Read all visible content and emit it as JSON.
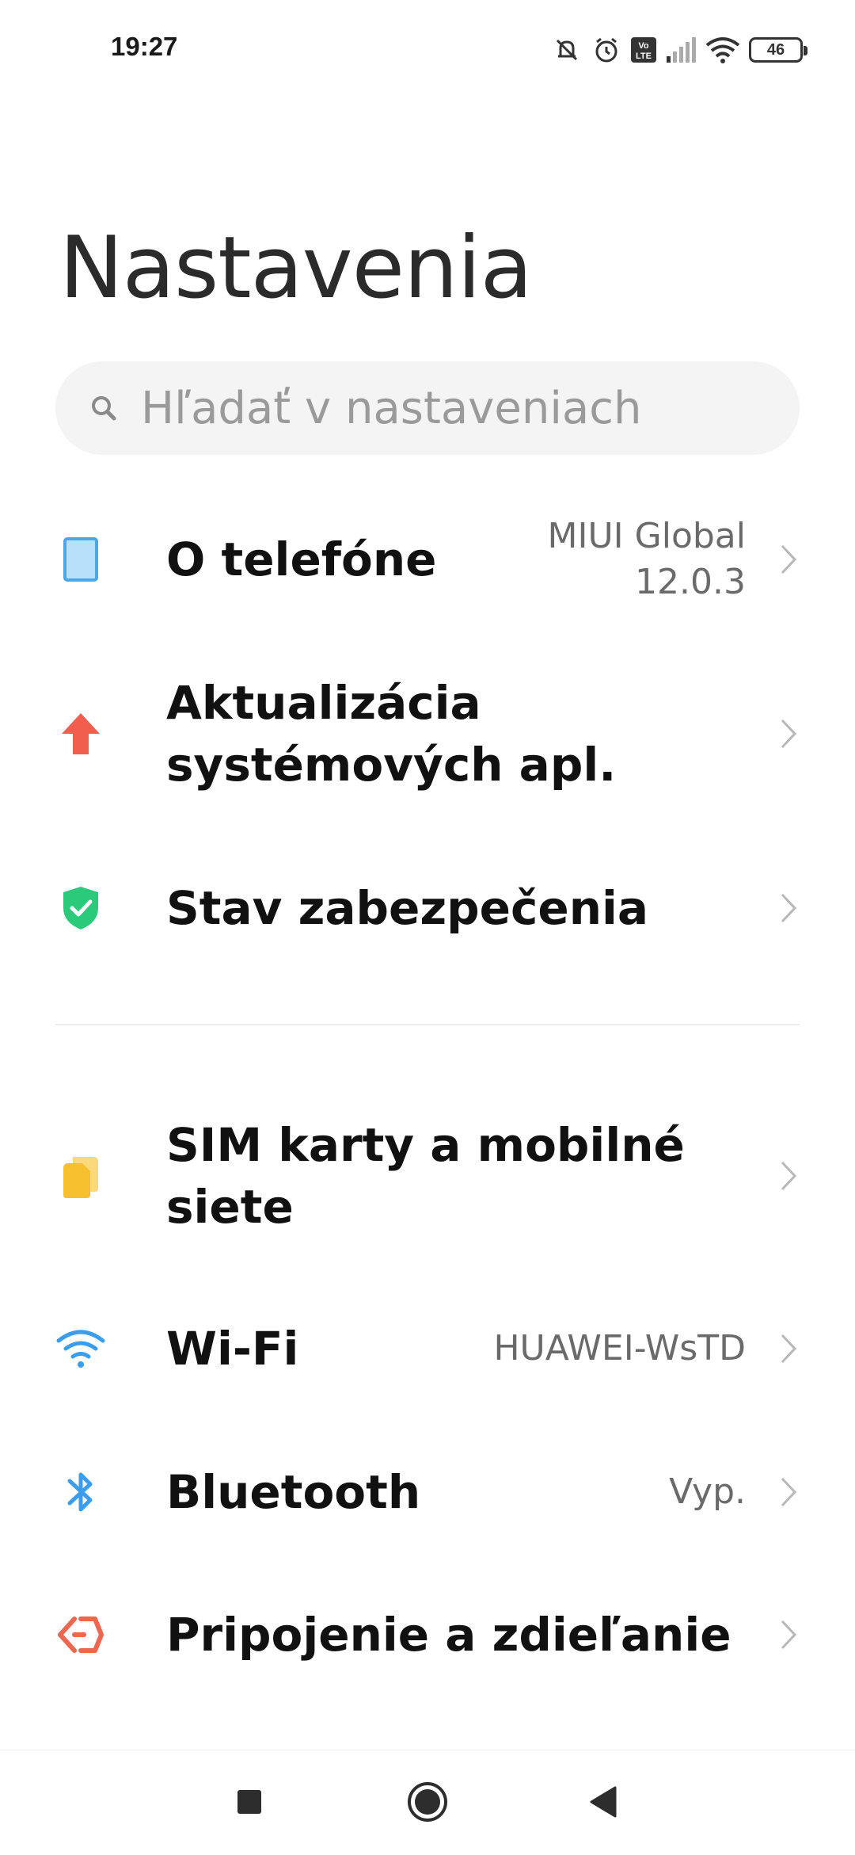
{
  "status_bar": {
    "time": "19:27",
    "volte_label": "Vo LTE",
    "battery_level": "46",
    "icons": [
      "silent-icon",
      "alarm-icon",
      "volte-icon",
      "signal-icon",
      "wifi-icon",
      "battery-icon"
    ]
  },
  "header": {
    "title": "Nastavenia"
  },
  "search": {
    "placeholder": "Hľadať v nastaveniach"
  },
  "items": [
    {
      "label": "O telefóne",
      "value": "MIUI Global\n12.0.3",
      "icon": "phone-icon",
      "color": "#4aa8e8"
    },
    {
      "label": "Aktualizácia\nsystémových apl.",
      "value": "",
      "icon": "update-arrow-icon",
      "color": "#f25e4e"
    },
    {
      "label": "Stav zabezpečenia",
      "value": "",
      "icon": "shield-icon",
      "color": "#2bc97a"
    },
    {
      "label": "SIM karty a mobilné\nsiete",
      "value": "",
      "icon": "sim-icon",
      "color": "#f7c02f"
    },
    {
      "label": "Wi-Fi",
      "value": "HUAWEI-WsTD",
      "icon": "wifi-icon",
      "color": "#3a9ded"
    },
    {
      "label": "Bluetooth",
      "value": "Vyp.",
      "icon": "bluetooth-icon",
      "color": "#3a9ded"
    },
    {
      "label": "Pripojenie a zdieľanie",
      "value": "",
      "icon": "connection-share-icon",
      "color": "#f0664e"
    }
  ],
  "nav": {
    "icons": [
      "recents-square-icon",
      "home-circle-icon",
      "back-triangle-icon"
    ]
  }
}
